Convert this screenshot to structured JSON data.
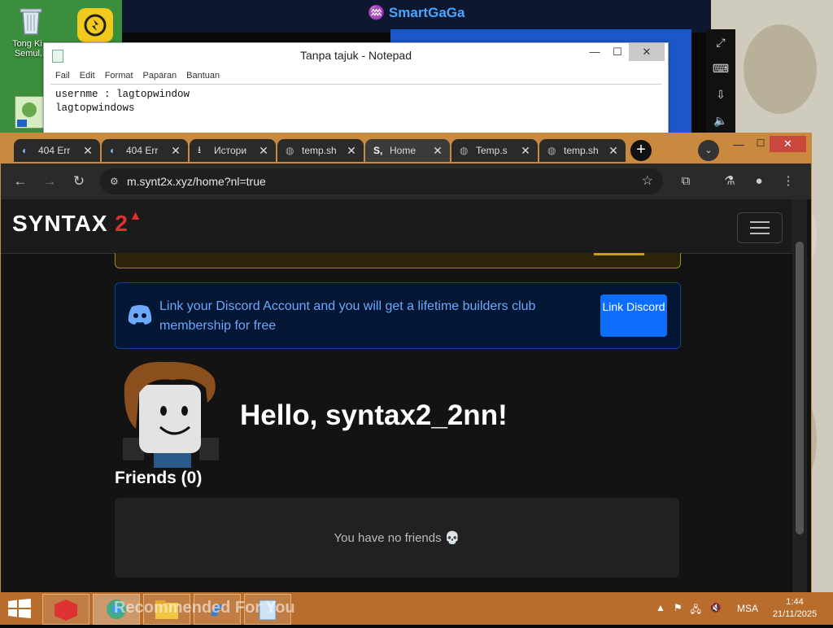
{
  "desktop": {
    "icons": [
      {
        "label": "Tong Ki... Semul...",
        "icon": "recycle-bin-icon"
      },
      {
        "label": "",
        "icon": "smartgaga-launcher-icon"
      },
      {
        "label": "",
        "icon": "shortcut-icon"
      }
    ]
  },
  "smartgaga": {
    "title": "SmartGaGa"
  },
  "notepad": {
    "title": "Tanpa tajuk - Notepad",
    "menu": [
      "Fail",
      "Edit",
      "Format",
      "Paparan",
      "Bantuan"
    ],
    "content": "usernme : lagtopwindow\nlagtopwindows"
  },
  "browser": {
    "tabs": [
      {
        "label": "404 Err",
        "icon": "loading-icon",
        "active": false
      },
      {
        "label": "404 Err",
        "icon": "loading-icon",
        "active": false
      },
      {
        "label": "Истори",
        "icon": "download-icon",
        "active": false
      },
      {
        "label": "temp.sh",
        "icon": "globe-icon",
        "active": false
      },
      {
        "label": "Home",
        "icon": "syntax-favicon",
        "active": true
      },
      {
        "label": "Temp.s",
        "icon": "globe-icon",
        "active": false
      },
      {
        "label": "temp.sh",
        "icon": "globe-icon",
        "active": false
      }
    ],
    "url": "m.synt2x.xyz/home?nl=true"
  },
  "site": {
    "logo_text": "SYNTAX",
    "logo_number": "2",
    "discord_alert": "Link your Discord Account and you will get a lifetime builders club membership for free",
    "discord_button": "Link Discord",
    "greeting": "Hello, syntax2_2nn!",
    "friends_title": "Friends (0)",
    "no_friends_text": "You have no friends 💀"
  },
  "taskbar": {
    "watermark": "Recommended For You",
    "language": "MSA",
    "time": "1:44",
    "date": "21/11/2025"
  }
}
